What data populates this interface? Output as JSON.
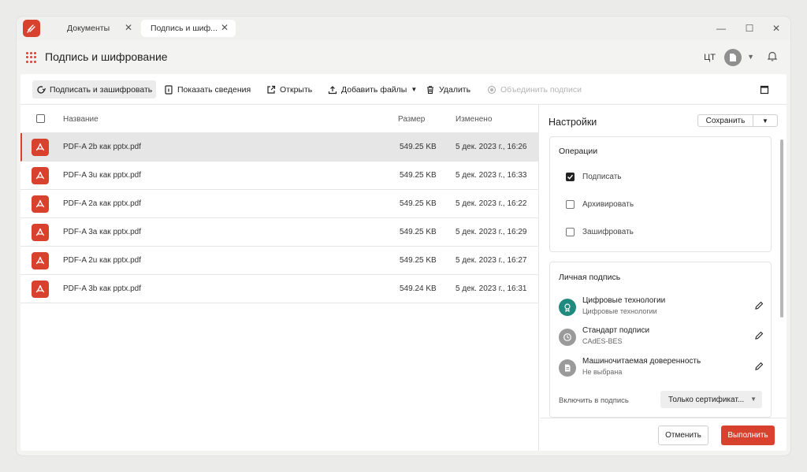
{
  "colors": {
    "accent": "#d9412f",
    "teal": "#1f8a7e",
    "gray_icon": "#9a9a9a"
  },
  "titlebar": {
    "tabs": [
      {
        "label": "Документы",
        "close": "✕"
      },
      {
        "label": "Подпись и шиф...",
        "close": "✕"
      }
    ],
    "controls": {
      "minimize": "—",
      "maximize": "☐",
      "close": "✕"
    }
  },
  "header": {
    "title": "Подпись и шифрование",
    "user_initials": "ЦТ"
  },
  "toolbar": {
    "sign_encrypt": "Подписать и зашифровать",
    "show_info": "Показать сведения",
    "open": "Открыть",
    "add_files": "Добавить файлы",
    "delete": "Удалить",
    "merge_signatures": "Объединить подписи"
  },
  "table": {
    "columns": {
      "name": "Название",
      "size": "Размер",
      "modified": "Изменено"
    },
    "rows": [
      {
        "name": "PDF-A 2b как pptx.pdf",
        "size": "549.25 KB",
        "modified": "5 дек. 2023 г., 16:26"
      },
      {
        "name": "PDF-A 3u как pptx.pdf",
        "size": "549.25 KB",
        "modified": "5 дек. 2023 г., 16:33"
      },
      {
        "name": "PDF-A 2a как pptx.pdf",
        "size": "549.25 KB",
        "modified": "5 дек. 2023 г., 16:22"
      },
      {
        "name": "PDF-A 3a как pptx.pdf",
        "size": "549.25 KB",
        "modified": "5 дек. 2023 г., 16:29"
      },
      {
        "name": "PDF-A 2u как pptx.pdf",
        "size": "549.25 KB",
        "modified": "5 дек. 2023 г., 16:27"
      },
      {
        "name": "PDF-A 3b как pptx.pdf",
        "size": "549.24 KB",
        "modified": "5 дек. 2023 г., 16:31"
      }
    ]
  },
  "settings": {
    "title": "Настройки",
    "save_label": "Сохранить",
    "operations": {
      "title": "Операции",
      "items": [
        {
          "label": "Подписать",
          "checked": true
        },
        {
          "label": "Архивировать",
          "checked": false
        },
        {
          "label": "Зашифровать",
          "checked": false
        }
      ]
    },
    "personal_signature": {
      "title": "Личная подпись",
      "certificate": {
        "title": "Цифровые технологии",
        "subtitle": "Цифровые технологии"
      },
      "standard": {
        "title": "Стандарт подписи",
        "subtitle": "CAdES-BES"
      },
      "power_of_attorney": {
        "title": "Машиночитаемая доверенность",
        "subtitle": "Не выбрана"
      },
      "include_label": "Включить в подпись",
      "include_value": "Только сертификат..."
    },
    "footer": {
      "cancel": "Отменить",
      "run": "Выполнить"
    }
  }
}
